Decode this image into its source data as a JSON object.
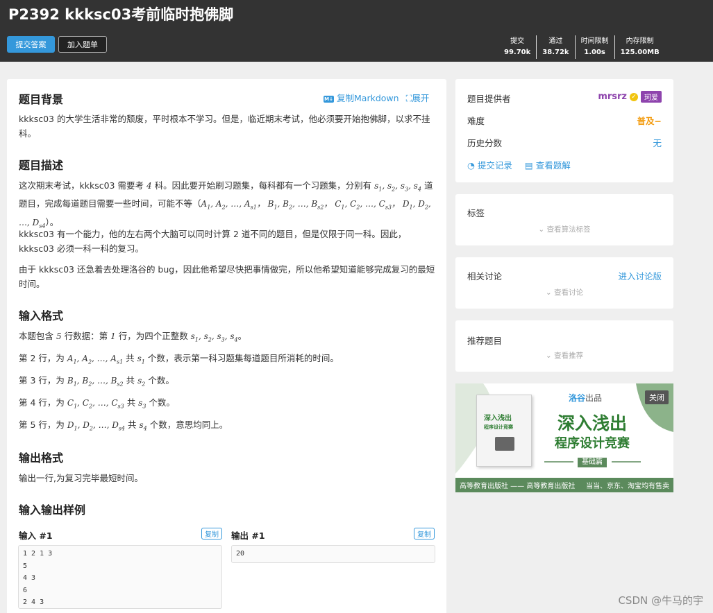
{
  "header": {
    "title": "P2392 kkksc03考前临时抱佛脚",
    "submit_label": "提交答案",
    "add_label": "加入题单",
    "stats": [
      {
        "label": "提交",
        "value": "99.70k"
      },
      {
        "label": "通过",
        "value": "38.72k"
      },
      {
        "label": "时间限制",
        "value": "1.00s"
      },
      {
        "label": "内存限制",
        "value": "125.00MB"
      }
    ]
  },
  "main": {
    "copy_markdown": "复制Markdown",
    "expand": "展开",
    "md_icon": "M↓",
    "sections": {
      "background_title": "题目背景",
      "background_text": "kkksc03 的大学生活非常的颓废，平时根本不学习。但是，临近期末考试，他必须要开始抱佛脚，以求不挂科。",
      "description_title": "题目描述",
      "desc_p1_a": "这次期末考试，kkksc03 需要考 ",
      "desc_p1_num": "4",
      "desc_p1_b": " 科。因此要开始刷习题集，每科都有一个习题集，分别有 ",
      "desc_p1_c": " 道题目，完成每道题目需要一些时间，可能不等（",
      "desc_p1_d": "）。",
      "desc_p2": "kkksc03 有一个能力，他的左右两个大脑可以同时计算 2 道不同的题目，但是仅限于同一科。因此，kkksc03 必须一科一科的复习。",
      "desc_p3": "由于 kkksc03 还急着去处理洛谷的 bug，因此他希望尽快把事情做完，所以他希望知道能够完成复习的最短时间。",
      "input_title": "输入格式",
      "input_l1_a": "本题包含 ",
      "input_l1_num": "5",
      "input_l1_b": " 行数据：第 ",
      "input_l1_c": "1",
      "input_l1_d": " 行，为四个正整数 ",
      "input_l2_a": "第 2 行，为 ",
      "input_l2_b": " 共 ",
      "input_l2_c": " 个数，表示第一科习题集每道题目所消耗的时间。",
      "input_l3_a": "第 3 行，为 ",
      "input_l3_b": " 共 ",
      "input_l3_c": " 个数。",
      "input_l4_a": "第 4 行，为 ",
      "input_l4_b": " 共 ",
      "input_l4_c": " 个数。",
      "input_l5_a": "第 5 行，为 ",
      "input_l5_b": " 共 ",
      "input_l5_c": " 个数，意思均同上。",
      "output_title": "输出格式",
      "output_text": "输出一行,为复习完毕最短时间。",
      "samples_title": "输入输出样例"
    },
    "sample": {
      "input_label": "输入 #1",
      "output_label": "输出 #1",
      "copy": "复制",
      "input_text": "1 2 1 3\n5\n4 3\n6\n2 4 3",
      "output_text": "20"
    }
  },
  "sidebar": {
    "provider_label": "题目提供者",
    "provider_name": "mrsrz",
    "provider_badge": "珂爱",
    "difficulty_label": "难度",
    "difficulty_value": "普及−",
    "history_label": "历史分数",
    "history_value": "无",
    "submissions_link": "提交记录",
    "solutions_link": "查看题解",
    "tags_title": "标签",
    "tags_link": "查看算法标签",
    "discussion_title": "相关讨论",
    "discussion_enter": "进入讨论版",
    "discussion_link": "查看讨论",
    "recommend_title": "推荐题目",
    "recommend_link": "查看推荐"
  },
  "ad": {
    "brand": "洛谷",
    "brand_suffix": "出品",
    "title1": "深入浅出",
    "title2": "程序设计竞赛",
    "edition": "基础篇",
    "publisher": "高等教育出版社 —— 高等教育出版社",
    "sellers": "当当、京东、淘宝均有售卖",
    "close": "关闭",
    "book_title1": "深入浅出",
    "book_title2": "程序设计竞赛"
  },
  "watermark": "CSDN @牛马的宇",
  "colors": {
    "accent": "#3498db",
    "header_bg": "#333333",
    "difficulty": "#f39c11",
    "provider": "#8e44ad",
    "ad_green": "#5b8a5c"
  }
}
